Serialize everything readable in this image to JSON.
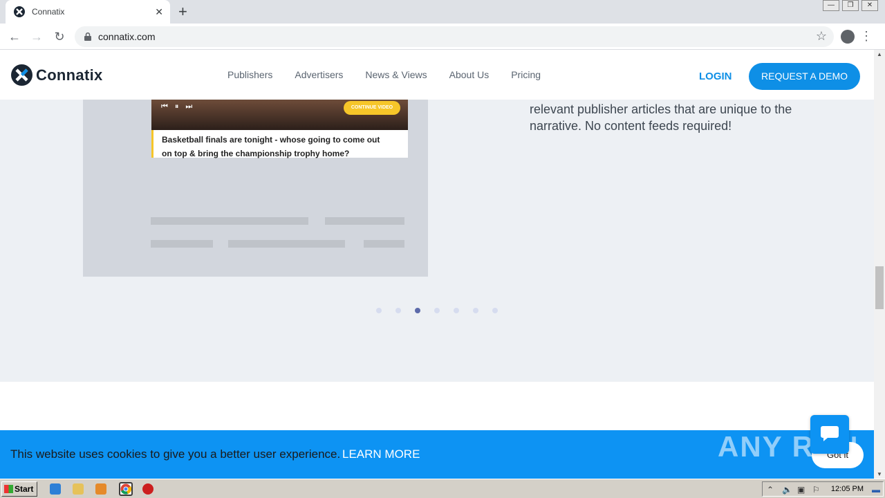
{
  "browser": {
    "tab_title": "Connatix",
    "tab_close": "✕",
    "new_tab": "+",
    "url": "connatix.com",
    "window_controls": [
      "—",
      "❐",
      "✕"
    ]
  },
  "site": {
    "brand": "Connatix",
    "brand_color": "#0e8fe6",
    "nav": [
      "Publishers",
      "Advertisers",
      "News & Views",
      "About Us",
      "Pricing"
    ],
    "login_label": "LOGIN",
    "demo_label": "REQUEST A DEMO"
  },
  "hero": {
    "continue_label": "CONTINUE VIDEO",
    "caption_line1": "Basketball finals are tonight - whose going to come out",
    "caption_line2": "on top & bring the championship trophy home?",
    "body_text": "relevant publisher articles that are unique to the narrative. No content feeds required!",
    "carousel_total": 7,
    "carousel_active_index": 2
  },
  "cookie": {
    "message": "This website uses cookies to give you a better user experience.",
    "learn_more": "LEARN MORE",
    "got_it": "Got it",
    "watermark": "ANY RUN"
  },
  "taskbar": {
    "start_label": "Start",
    "clock": "12:05 PM"
  }
}
